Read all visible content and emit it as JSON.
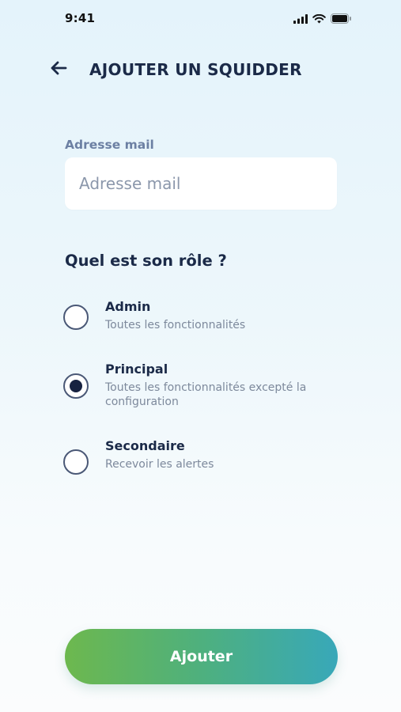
{
  "status_bar": {
    "time": "9:41",
    "icons": [
      "cellular-signal-icon",
      "wifi-icon",
      "battery-icon"
    ]
  },
  "header": {
    "back_icon": "arrow-left-icon",
    "title": "AJOUTER UN SQUIDDER"
  },
  "email": {
    "label": "Adresse mail",
    "placeholder": "Adresse mail",
    "value": ""
  },
  "role": {
    "question": "Quel est son rôle ?",
    "options": [
      {
        "name": "Admin",
        "description": "Toutes les fonctionnalités",
        "selected": false
      },
      {
        "name": "Principal",
        "description": "Toutes les fonctionnalités excepté la configuration",
        "selected": true
      },
      {
        "name": "Secondaire",
        "description": "Recevoir les alertes",
        "selected": false
      }
    ]
  },
  "submit": {
    "label": "Ajouter"
  },
  "colors": {
    "text_dark": "#1b2a48",
    "label_muted": "#6c80a3",
    "button_gradient_start": "#6db84e",
    "button_gradient_end": "#38a8b9"
  }
}
